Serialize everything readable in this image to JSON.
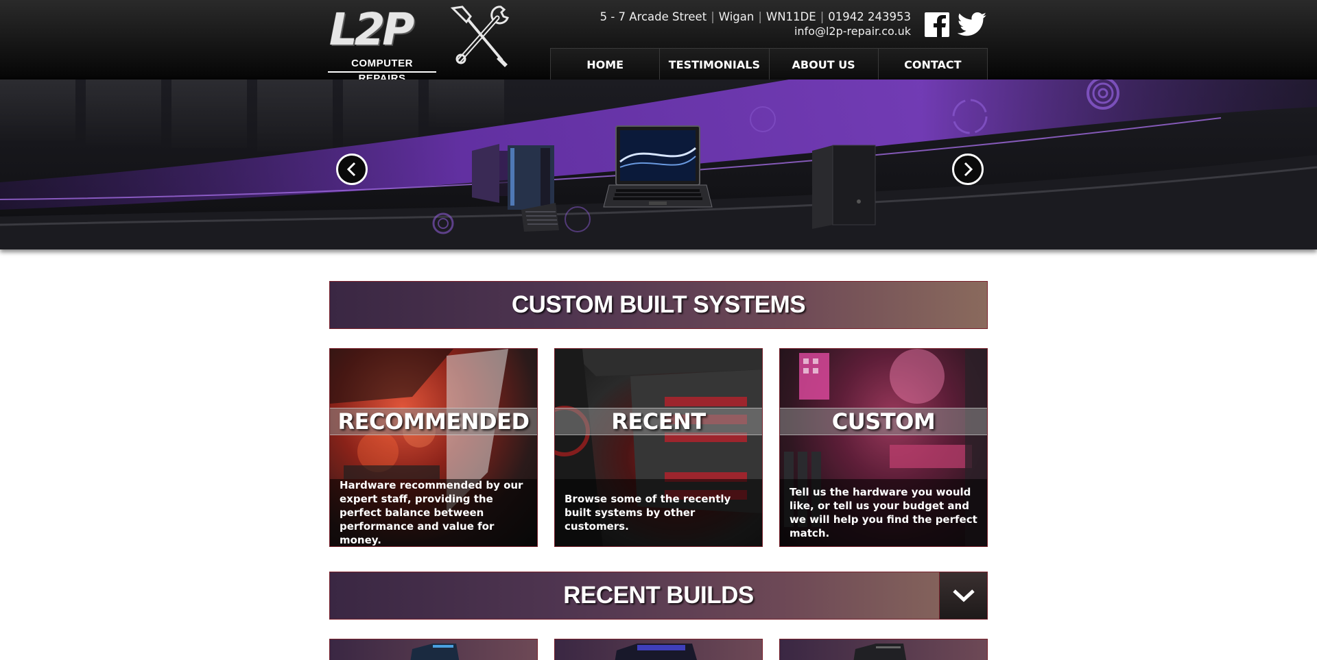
{
  "brand": {
    "logo_mark": "L2P",
    "logo_sub": "COMPUTER REPAIRS"
  },
  "contact": {
    "street": "5 - 7 Arcade Street",
    "town": "Wigan",
    "postcode": "WN11DE",
    "phone": "01942 243953",
    "separator": "|",
    "email": "info@l2p-repair.co.uk"
  },
  "social": {
    "facebook_icon": "facebook-icon",
    "twitter_icon": "twitter-icon"
  },
  "nav": {
    "items": [
      {
        "label": "HOME"
      },
      {
        "label": "TESTIMONIALS"
      },
      {
        "label": "ABOUT US"
      },
      {
        "label": "CONTACT"
      }
    ]
  },
  "hero": {
    "prev_icon": "chevron-left-icon",
    "next_icon": "chevron-right-icon",
    "accent": "#7b3fc4"
  },
  "sections": {
    "custom_built": {
      "title": "CUSTOM BUILT SYSTEMS",
      "cards": [
        {
          "label": "RECOMMENDED",
          "description": "Hardware recommended by our expert staff, providing the perfect balance between performance and value for money."
        },
        {
          "label": "RECENT",
          "description": "Browse some of the recently built systems by other customers."
        },
        {
          "label": "CUSTOM",
          "description": "Tell us the hardware you would like, or tell us your budget and we will help you find the perfect match."
        }
      ]
    },
    "recent_builds": {
      "title": "RECENT BUILDS",
      "toggle_icon": "chevron-down-icon"
    }
  },
  "colors": {
    "header_bg": "#111111",
    "banner_border": "#7a1f2a",
    "banner_purple": "#4f3550",
    "text": "#ffffff"
  }
}
